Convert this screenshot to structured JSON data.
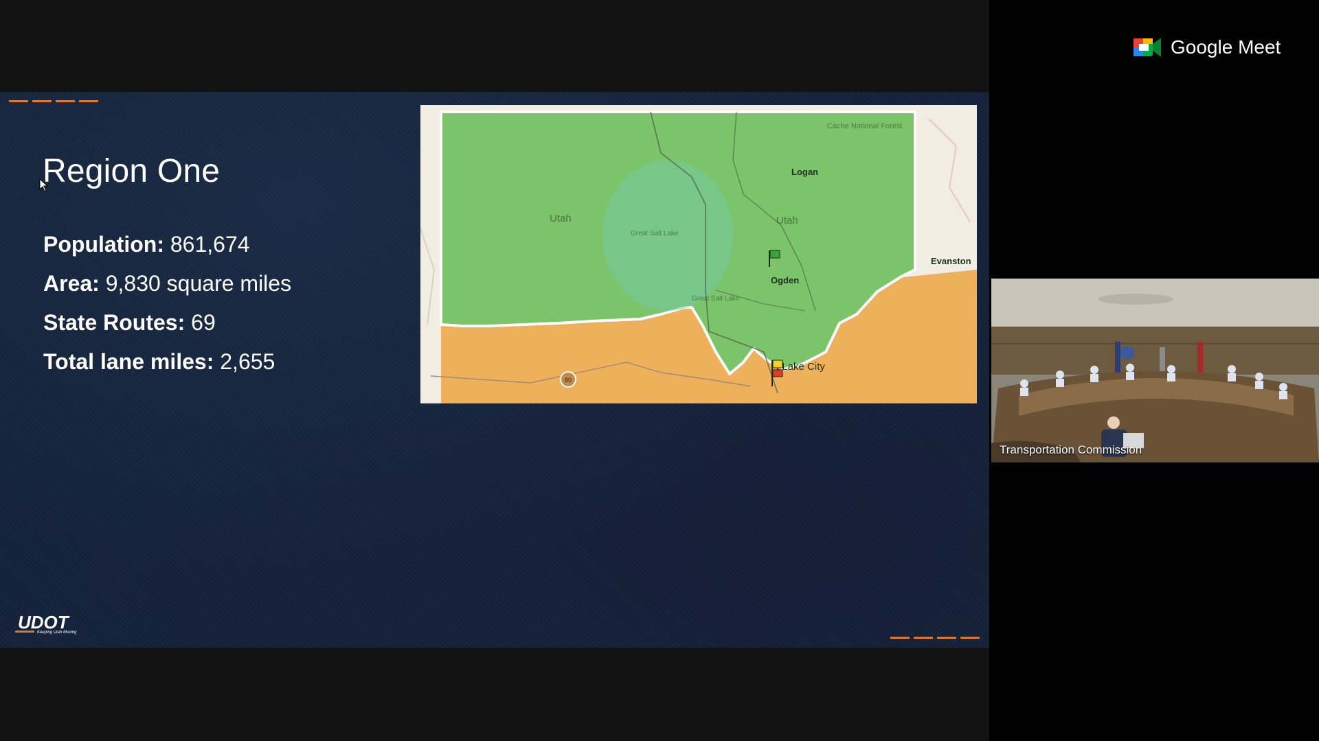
{
  "meet": {
    "brand_name": "Google Meet",
    "participant_name": "Transportation Commission"
  },
  "slide": {
    "title": "Region One",
    "stats": [
      {
        "label": "Population:",
        "value": "861,674"
      },
      {
        "label": "Area:",
        "value": "9,830 square miles"
      },
      {
        "label": "State Routes:",
        "value": "69"
      },
      {
        "label": "Total lane miles:",
        "value": "2,655"
      }
    ],
    "logo_text": "UDOT",
    "logo_tagline": "Keeping Utah Moving"
  },
  "map": {
    "labels": {
      "forest": "Cache National Forest",
      "logan": "Logan",
      "utah_west": "Utah",
      "utah_east": "Utah",
      "great_salt_lake": "Great Salt Lake",
      "great_salt_lake_south": "Great Salt Lake",
      "evanston": "Evanston",
      "ogden": "Ogden",
      "salt_lake_city": "t Lake City",
      "interstate": "80"
    }
  },
  "colors": {
    "accent": "#e07a2a",
    "region_one": "#7cc46a",
    "neighbor_region": "#eeb05b",
    "slide_background": "#14223a"
  },
  "icons": {
    "meet_logo": "google-meet-logo-icon",
    "cursor": "mouse-pointer-icon",
    "flag_ogden": "green-flag-icon",
    "flag_slc": "yellow-red-flag-icon"
  }
}
